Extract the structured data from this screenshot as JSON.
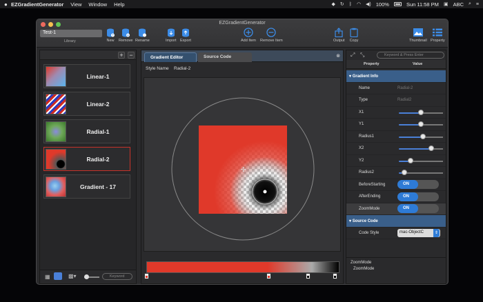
{
  "menubar": {
    "app": "EZGradientGenerator",
    "items": [
      "View",
      "Window",
      "Help"
    ],
    "battery": "100%",
    "clock": "Sun 11:58 PM",
    "input": "ABC"
  },
  "window": {
    "title": "EZGradientGenerator"
  },
  "toolbar": {
    "library_field": "Test-1",
    "library_label": "Library",
    "new": "New",
    "remove": "Remove",
    "rename": "Rename",
    "import": "Import",
    "export": "Export",
    "add_item": "Add Item",
    "remove_item": "Remove Item",
    "output": "Output",
    "copy": "Copy",
    "thumbnail": "Thumbnail",
    "property": "Property"
  },
  "sidebar": {
    "items": [
      {
        "label": "Linear-1"
      },
      {
        "label": "Linear-2"
      },
      {
        "label": "Radial-1"
      },
      {
        "label": "Radial-2"
      },
      {
        "label": "Gradient - 17"
      }
    ],
    "search_placeholder": "Keyword"
  },
  "editor": {
    "tabs": [
      "Gradient Editor",
      "Source Code"
    ],
    "style_name_label": "Style Name",
    "style_name_value": "Radial-2",
    "stop_colors": [
      "#e0392a",
      "#e0392a",
      "#dddddd",
      "#000000"
    ]
  },
  "inspector": {
    "search_placeholder": "Keyword & Press Enter",
    "col_property": "Property",
    "col_value": "Value",
    "section_gradient": "Gradient Info",
    "section_source": "Source Code",
    "name_label": "Name",
    "name_value": "Radial-2",
    "type_label": "Type",
    "type_value": "Radial2",
    "x1_label": "X1",
    "x1_value": 0.5,
    "y1_label": "Y1",
    "y1_value": 0.5,
    "radius1_label": "Radius1",
    "radius1_value": 0.55,
    "x2_label": "X2",
    "x2_value": 0.75,
    "y2_label": "Y2",
    "y2_value": 0.25,
    "radius2_label": "Radius2",
    "radius2_value": 0.1,
    "before_label": "BeforeStarting",
    "before_value": "ON",
    "after_label": "AfterEnding",
    "after_value": "ON",
    "zoom_label": "ZoomMode",
    "zoom_value": "ON",
    "codestyle_label": "Code Style",
    "codestyle_value": "mac-ObjectC",
    "help_title": "ZoomMode",
    "help_text": "ZoomMode"
  }
}
